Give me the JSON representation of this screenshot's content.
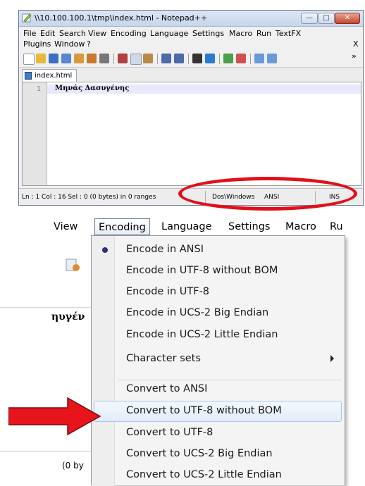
{
  "window": {
    "title": "\\\\10.100.100.1\\tmp\\index.html - Notepad++",
    "min_glyph": "—",
    "max_glyph": "□",
    "close_glyph": "✕"
  },
  "menu": {
    "file": "File",
    "edit": "Edit",
    "search": "Search",
    "view": "View",
    "encoding": "Encoding",
    "language": "Language",
    "settings": "Settings",
    "macro": "Macro",
    "run": "Run",
    "textfx": "TextFX",
    "plugins": "Plugins",
    "window": "Window",
    "help": "?",
    "close_x": "X",
    "overflow": "»"
  },
  "tab": {
    "label": "index.html"
  },
  "editor": {
    "line_number": "1",
    "line_text": "Μηνάς Δασυγένης"
  },
  "status": {
    "position": "Ln : 1    Col : 16    Sel : 0 (0 bytes) in 0 ranges",
    "eol": "Dos\\Windows",
    "encoding": "ANSI",
    "mode": "INS"
  },
  "zoom": {
    "menubar": {
      "view_fragment": "View",
      "encoding": "Encoding",
      "language": "Language",
      "settings": "Settings",
      "macro": "Macro",
      "run_fragment": "Ru"
    },
    "fragment_text": "ηυγέν",
    "status_fragment": "(0 by"
  },
  "encoding_menu": {
    "items": [
      "Encode in ANSI",
      "Encode in UTF-8 without BOM",
      "Encode in UTF-8",
      "Encode in UCS-2 Big Endian",
      "Encode in UCS-2 Little Endian",
      "Character sets",
      "Convert to ANSI",
      "Convert to UTF-8 without BOM",
      "Convert to UTF-8",
      "Convert to UCS-2 Big Endian",
      "Convert to UCS-2 Little Endian"
    ],
    "checked": "Encode in ANSI",
    "highlighted": "Convert to UTF-8 without BOM"
  },
  "colors": {
    "annotation_red": "#e0101a",
    "selection_border": "#a8c6ea"
  }
}
